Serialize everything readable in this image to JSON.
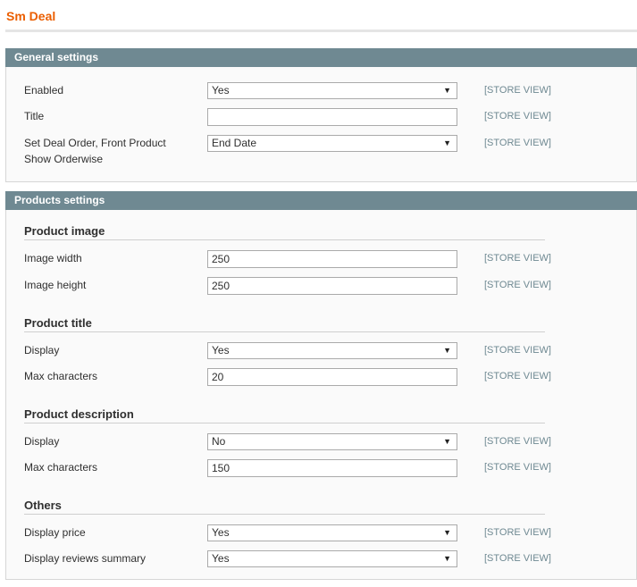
{
  "page": {
    "title": "Sm Deal"
  },
  "general": {
    "header": "General settings",
    "enabled": {
      "label": "Enabled",
      "value": "Yes",
      "scope": "[STORE VIEW]"
    },
    "title_field": {
      "label": "Title",
      "value": "",
      "scope": "[STORE VIEW]"
    },
    "deal_order": {
      "label_line1": "Set Deal Order, Front Product",
      "label_line2": "Show Orderwise",
      "value": "End Date",
      "scope": "[STORE VIEW]"
    }
  },
  "products": {
    "header": "Products settings",
    "image": {
      "title": "Product image",
      "width": {
        "label": "Image width",
        "value": "250",
        "scope": "[STORE VIEW]"
      },
      "height": {
        "label": "Image height",
        "value": "250",
        "scope": "[STORE VIEW]"
      }
    },
    "ptitle": {
      "title": "Product title",
      "display": {
        "label": "Display",
        "value": "Yes",
        "scope": "[STORE VIEW]"
      },
      "max": {
        "label": "Max characters",
        "value": "20",
        "scope": "[STORE VIEW]"
      }
    },
    "pdesc": {
      "title": "Product description",
      "display": {
        "label": "Display",
        "value": "No",
        "scope": "[STORE VIEW]"
      },
      "max": {
        "label": "Max characters",
        "value": "150",
        "scope": "[STORE VIEW]"
      }
    },
    "others": {
      "title": "Others",
      "price": {
        "label": "Display price",
        "value": "Yes",
        "scope": "[STORE VIEW]"
      },
      "reviews": {
        "label": "Display reviews summary",
        "value": "Yes",
        "scope": "[STORE VIEW]"
      }
    }
  },
  "icons": {
    "dropdown": "chevron-down-icon"
  },
  "colors": {
    "title": "#eb5e00",
    "section_header": "#6f8992",
    "scope_text": "#6f8992"
  }
}
